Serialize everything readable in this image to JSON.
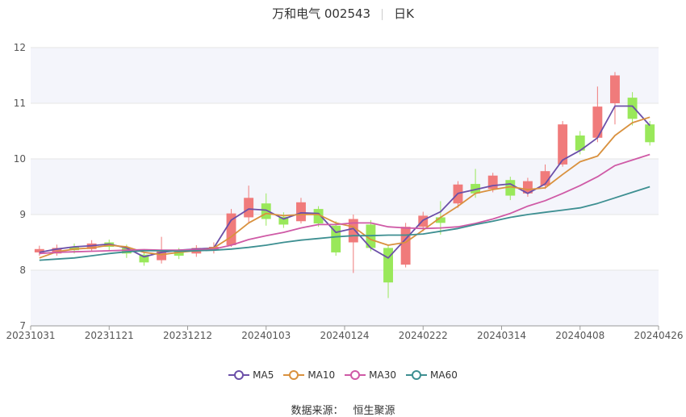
{
  "header": {
    "stock": "万和电气 002543",
    "period": "日K"
  },
  "footer": {
    "source_label": "数据来源：",
    "source_name": "恒生聚源"
  },
  "colors": {
    "up": "#f07b7b",
    "down": "#99e85a",
    "grid": "#e6e6e6",
    "band": "#f4f5fb"
  },
  "chart_data": {
    "type": "candlestick",
    "x_ticks": [
      "20231031",
      "20231121",
      "20231212",
      "20240103",
      "20240124",
      "20240222",
      "20240314",
      "20240408",
      "20240426"
    ],
    "y_ticks": [
      7,
      8,
      9,
      10,
      11,
      12
    ],
    "ylim": [
      7,
      12
    ],
    "grid": true,
    "legend_position": "bottom",
    "series": [
      {
        "name": "MA5",
        "color": "#6b4fa8",
        "values": [
          8.32,
          8.38,
          8.42,
          8.44,
          8.47,
          8.4,
          8.24,
          8.32,
          8.36,
          8.38,
          8.4,
          8.9,
          9.1,
          9.08,
          8.92,
          9.03,
          9.02,
          8.68,
          8.75,
          8.4,
          8.22,
          8.56,
          8.9,
          9.05,
          9.38,
          9.45,
          9.52,
          9.55,
          9.38,
          9.55,
          9.98,
          10.15,
          10.38,
          10.95,
          10.95,
          10.6
        ]
      },
      {
        "name": "MA10",
        "color": "#d9913e",
        "values": [
          8.22,
          8.33,
          8.38,
          8.4,
          8.45,
          8.42,
          8.32,
          8.28,
          8.32,
          8.35,
          8.4,
          8.6,
          8.85,
          9.02,
          8.98,
          9.0,
          9.0,
          8.85,
          8.78,
          8.55,
          8.45,
          8.5,
          8.72,
          8.95,
          9.15,
          9.38,
          9.45,
          9.5,
          9.45,
          9.48,
          9.72,
          9.95,
          10.05,
          10.42,
          10.65,
          10.75
        ]
      },
      {
        "name": "MA30",
        "color": "#cf5aa6",
        "values": [
          8.3,
          8.32,
          8.33,
          8.34,
          8.35,
          8.36,
          8.37,
          8.36,
          8.36,
          8.37,
          8.38,
          8.45,
          8.55,
          8.62,
          8.68,
          8.76,
          8.82,
          8.82,
          8.85,
          8.85,
          8.78,
          8.76,
          8.75,
          8.76,
          8.78,
          8.84,
          8.92,
          9.02,
          9.15,
          9.25,
          9.38,
          9.52,
          9.68,
          9.88,
          9.98,
          10.08
        ]
      },
      {
        "name": "MA60",
        "color": "#3d8f91",
        "values": [
          8.18,
          8.2,
          8.22,
          8.26,
          8.3,
          8.33,
          8.35,
          8.35,
          8.34,
          8.35,
          8.36,
          8.38,
          8.41,
          8.45,
          8.5,
          8.54,
          8.57,
          8.6,
          8.62,
          8.62,
          8.63,
          8.63,
          8.65,
          8.7,
          8.75,
          8.82,
          8.88,
          8.95,
          9.0,
          9.04,
          9.08,
          9.12,
          9.2,
          9.3,
          9.4,
          9.5
        ]
      }
    ],
    "candles": [
      {
        "o": 8.32,
        "c": 8.38,
        "h": 8.44,
        "l": 8.26
      },
      {
        "o": 8.3,
        "c": 8.4,
        "h": 8.46,
        "l": 8.26
      },
      {
        "o": 8.42,
        "c": 8.36,
        "h": 8.48,
        "l": 8.3
      },
      {
        "o": 8.38,
        "c": 8.48,
        "h": 8.54,
        "l": 8.34
      },
      {
        "o": 8.5,
        "c": 8.42,
        "h": 8.55,
        "l": 8.36
      },
      {
        "o": 8.4,
        "c": 8.3,
        "h": 8.46,
        "l": 8.22
      },
      {
        "o": 8.28,
        "c": 8.14,
        "h": 8.32,
        "l": 8.08
      },
      {
        "o": 8.18,
        "c": 8.34,
        "h": 8.6,
        "l": 8.12
      },
      {
        "o": 8.34,
        "c": 8.26,
        "h": 8.4,
        "l": 8.2
      },
      {
        "o": 8.3,
        "c": 8.4,
        "h": 8.45,
        "l": 8.24
      },
      {
        "o": 8.36,
        "c": 8.42,
        "h": 8.5,
        "l": 8.3
      },
      {
        "o": 8.45,
        "c": 9.02,
        "h": 9.1,
        "l": 8.42
      },
      {
        "o": 8.95,
        "c": 9.3,
        "h": 9.52,
        "l": 8.85
      },
      {
        "o": 9.2,
        "c": 8.92,
        "h": 9.38,
        "l": 8.8
      },
      {
        "o": 8.96,
        "c": 8.82,
        "h": 9.04,
        "l": 8.76
      },
      {
        "o": 8.88,
        "c": 9.22,
        "h": 9.3,
        "l": 8.84
      },
      {
        "o": 9.1,
        "c": 8.84,
        "h": 9.15,
        "l": 8.78
      },
      {
        "o": 8.8,
        "c": 8.32,
        "h": 8.88,
        "l": 8.26
      },
      {
        "o": 8.5,
        "c": 8.92,
        "h": 9.0,
        "l": 7.95
      },
      {
        "o": 8.82,
        "c": 8.4,
        "h": 8.9,
        "l": 8.34
      },
      {
        "o": 8.4,
        "c": 7.78,
        "h": 8.46,
        "l": 7.5
      },
      {
        "o": 8.1,
        "c": 8.78,
        "h": 8.85,
        "l": 8.05
      },
      {
        "o": 8.78,
        "c": 8.98,
        "h": 9.05,
        "l": 8.7
      },
      {
        "o": 8.95,
        "c": 8.85,
        "h": 9.24,
        "l": 8.64
      },
      {
        "o": 9.2,
        "c": 9.54,
        "h": 9.6,
        "l": 9.12
      },
      {
        "o": 9.55,
        "c": 9.38,
        "h": 9.82,
        "l": 9.3
      },
      {
        "o": 9.46,
        "c": 9.7,
        "h": 9.75,
        "l": 9.4
      },
      {
        "o": 9.62,
        "c": 9.34,
        "h": 9.68,
        "l": 9.26
      },
      {
        "o": 9.38,
        "c": 9.6,
        "h": 9.66,
        "l": 9.32
      },
      {
        "o": 9.52,
        "c": 9.78,
        "h": 9.9,
        "l": 9.46
      },
      {
        "o": 9.9,
        "c": 10.62,
        "h": 10.68,
        "l": 9.86
      },
      {
        "o": 10.42,
        "c": 10.15,
        "h": 10.5,
        "l": 10.08
      },
      {
        "o": 10.38,
        "c": 10.94,
        "h": 11.3,
        "l": 10.3
      },
      {
        "o": 11.0,
        "c": 11.5,
        "h": 11.56,
        "l": 10.62
      },
      {
        "o": 11.1,
        "c": 10.72,
        "h": 11.2,
        "l": 10.6
      },
      {
        "o": 10.62,
        "c": 10.3,
        "h": 10.68,
        "l": 10.24
      }
    ]
  }
}
